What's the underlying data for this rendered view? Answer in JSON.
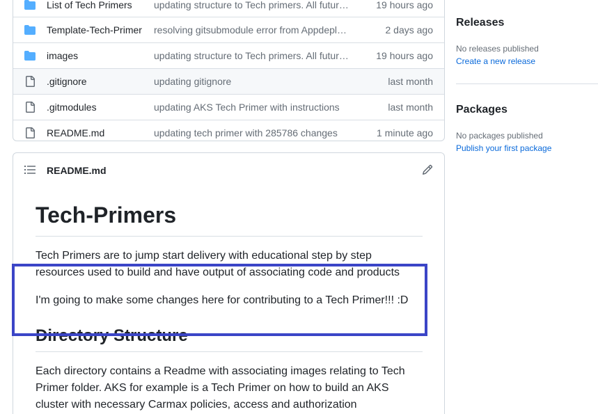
{
  "files": [
    {
      "name": "List of Tech Primers",
      "message": "updating structure to Tech primers. All future primer...",
      "age": "19 hours ago",
      "icon": "folder-icon"
    },
    {
      "name": "Template-Tech-Primer",
      "message": "resolving gitsubmodule error from Appdeploy...",
      "age": "2 days ago",
      "icon": "folder-icon"
    },
    {
      "name": "images",
      "message": "updating structure to Tech primers. All future primer...",
      "age": "19 hours ago",
      "icon": "folder-icon"
    },
    {
      "name": ".gitignore",
      "message": "updating gitignore",
      "age": "last month",
      "icon": "file-icon"
    },
    {
      "name": ".gitmodules",
      "message": "updating AKS Tech Primer with instructions",
      "age": "last month",
      "icon": "file-icon"
    },
    {
      "name": "README.md",
      "message": "updating tech primer with 285786 changes",
      "age": "1 minute ago",
      "icon": "file-icon"
    }
  ],
  "readme": {
    "filename": "README.md",
    "h1": "Tech-Primers",
    "p1": "Tech Primers are to jump start delivery with educational step by step resources used to build and have output of associating code and products",
    "p2": "I'm going to make some changes here for contributing to a Tech Primer!!! :D",
    "h2": "Directory Structure",
    "p3": "Each directory contains a Readme with associating images relating to Tech Primer folder. AKS for example is a Tech Primer on how to build an AKS cluster with necessary Carmax policies, access and authorization requirements, and"
  },
  "sidebar": {
    "releases_title": "Releases",
    "releases_empty": "No releases published",
    "releases_link": "Create a new release",
    "packages_title": "Packages",
    "packages_empty": "No packages published",
    "packages_link": "Publish your first package"
  },
  "colors": {
    "folder": "#54aeff",
    "link": "#0969da",
    "highlight_box": "#3b45c7"
  }
}
